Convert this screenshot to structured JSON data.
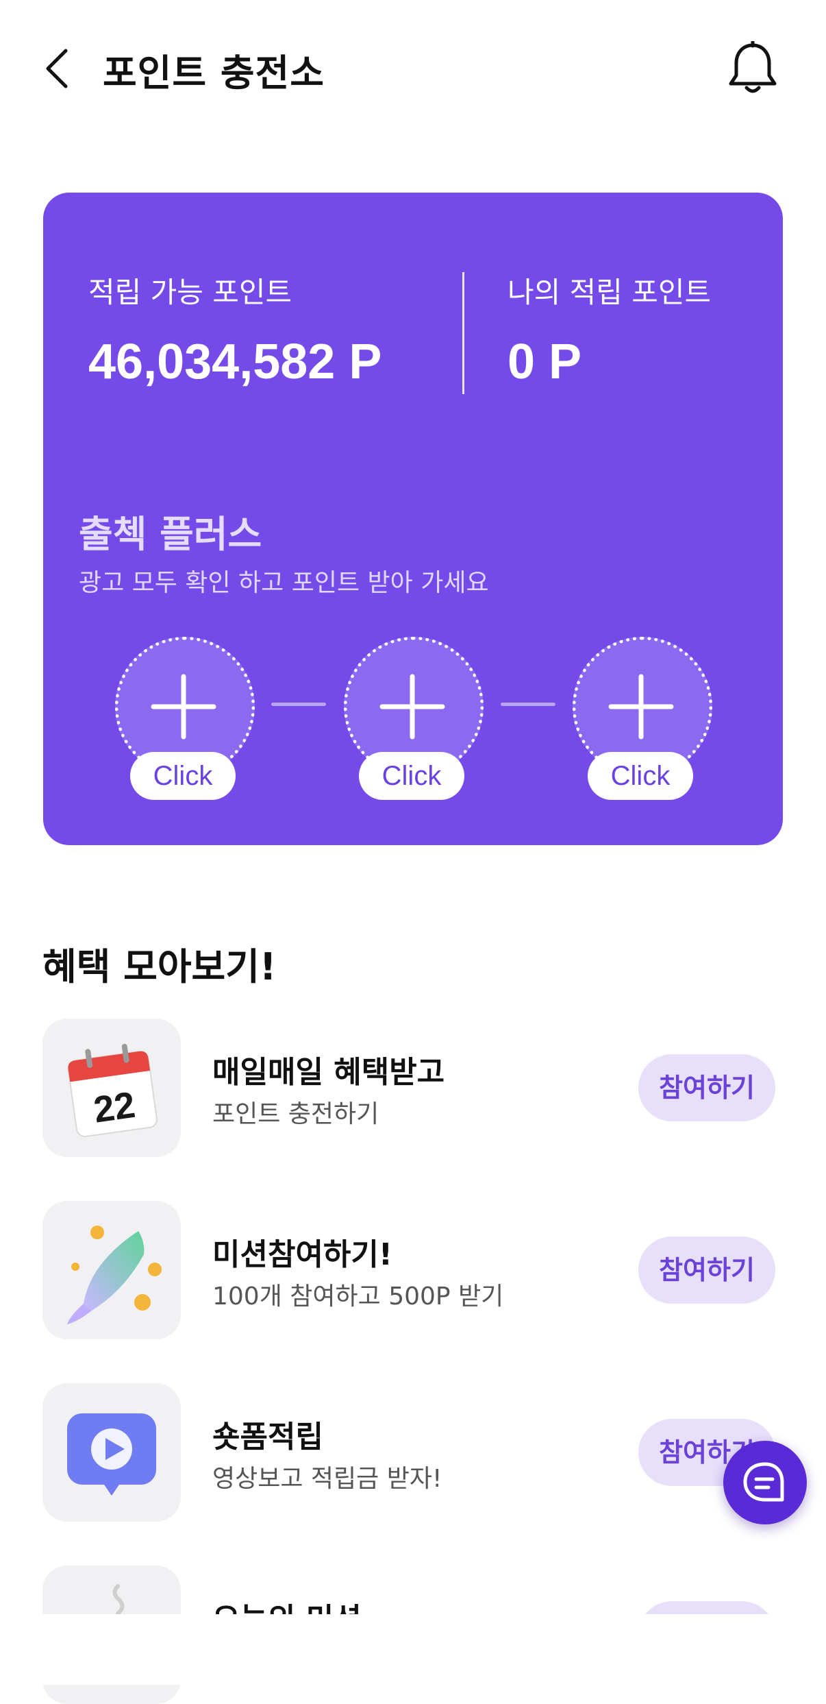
{
  "header": {
    "title": "포인트 충전소"
  },
  "points": {
    "available_label": "적립 가능 포인트",
    "available_value": "46,034,582 P",
    "mine_label": "나의 적립 포인트",
    "mine_value": "0 P"
  },
  "checkin": {
    "title": "출첵 플러스",
    "subtitle": "광고 모두 확인 하고 포인트 받아 가세요",
    "slots": [
      {
        "label": "Click"
      },
      {
        "label": "Click"
      },
      {
        "label": "Click"
      }
    ]
  },
  "benefits": {
    "title": "혜택 모아보기!",
    "items": [
      {
        "title": "매일매일 혜택받고",
        "subtitle": "포인트 충전하기",
        "button": "참여하기",
        "icon": "calendar-icon"
      },
      {
        "title": "미션참여하기!",
        "subtitle": "100개 참여하고 500P 받기",
        "button": "참여하기",
        "icon": "rocket-icon"
      },
      {
        "title": "숏폼적립",
        "subtitle": "영상보고 적립금 받자!",
        "button": "참여하기",
        "icon": "play-video-icon"
      },
      {
        "title": "오늘의 미션",
        "subtitle": "",
        "button": "",
        "icon": "mission-icon"
      }
    ]
  },
  "colors": {
    "accent": "#744be8",
    "fab": "#5a2ad6",
    "button_bg": "#e8e0fb"
  }
}
